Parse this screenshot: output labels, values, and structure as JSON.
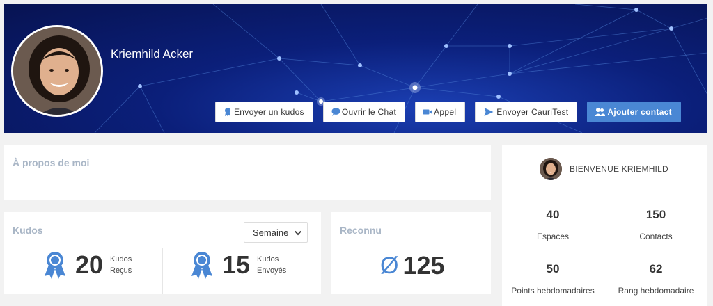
{
  "profile": {
    "name": "Kriemhild Acker"
  },
  "actions": [
    {
      "label": "Envoyer un kudos",
      "icon": "ribbon-icon"
    },
    {
      "label": "Ouvrir le Chat",
      "icon": "chat-bubble-icon"
    },
    {
      "label": "Appel",
      "icon": "video-camera-icon"
    },
    {
      "label": "Envoyer CauriTest",
      "icon": "paper-plane-icon"
    },
    {
      "label": "Ajouter contact",
      "icon": "add-users-icon"
    }
  ],
  "about": {
    "title": "À propos de moi"
  },
  "kudos": {
    "title": "Kudos",
    "period_selected": "Semaine",
    "received": {
      "value": "20",
      "label_line1": "Kudos",
      "label_line2": "Reçus"
    },
    "sent": {
      "value": "15",
      "label_line1": "Kudos",
      "label_line2": "Envoyés"
    }
  },
  "reconnu": {
    "title": "Reconnu",
    "symbol": "Ø",
    "value": "125"
  },
  "welcome": {
    "greeting": "BIENVENUE KRIEMHILD",
    "stats": [
      {
        "value": "40",
        "label": "Espaces"
      },
      {
        "value": "150",
        "label": "Contacts"
      },
      {
        "value": "50",
        "label": "Points hebdomadaires"
      },
      {
        "value": "62",
        "label": "Rang hebdomadaire"
      }
    ]
  },
  "colors": {
    "accent": "#4a87d4",
    "banner_dark": "#071352",
    "card_title": "#a9b6c6"
  }
}
